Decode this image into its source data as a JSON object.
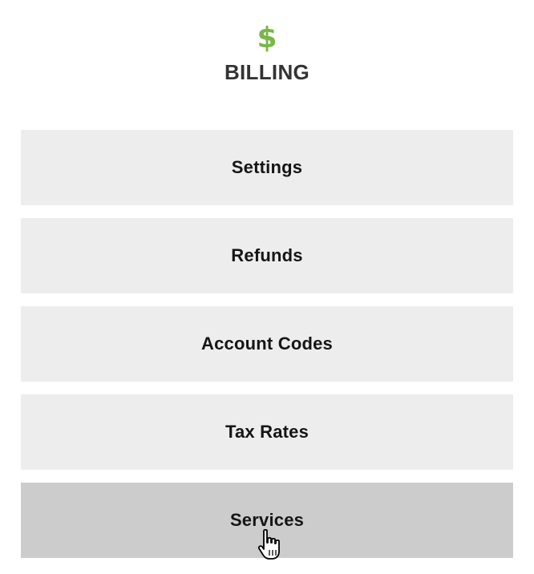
{
  "header": {
    "icon": "dollar-icon",
    "icon_glyph": "$",
    "icon_color": "#7ab648",
    "title": "BILLING"
  },
  "menu": {
    "items": [
      {
        "label": "Settings",
        "state": "default"
      },
      {
        "label": "Refunds",
        "state": "default"
      },
      {
        "label": "Account Codes",
        "state": "default"
      },
      {
        "label": "Tax Rates",
        "state": "default"
      },
      {
        "label": "Services",
        "state": "hovered"
      }
    ]
  },
  "colors": {
    "item_background": "#ededed",
    "item_hover_background": "#cccccc"
  },
  "cursor": {
    "icon": "hand-pointer-icon"
  }
}
